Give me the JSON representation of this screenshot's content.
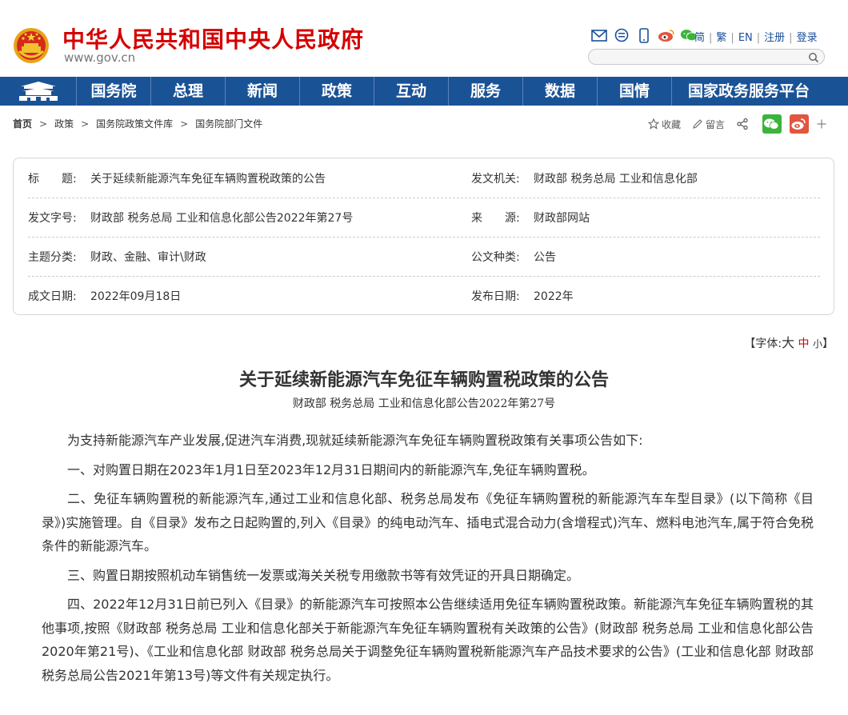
{
  "header": {
    "site_title": "中华人民共和国中央人民政府",
    "site_url": "www.gov.cn",
    "top_links": [
      "简",
      "繁",
      "EN",
      "注册",
      "登录"
    ],
    "search_placeholder": ""
  },
  "nav": [
    "国务院",
    "总理",
    "新闻",
    "政策",
    "互动",
    "服务",
    "数据",
    "国情",
    "国家政务服务平台"
  ],
  "breadcrumb": [
    "首页",
    "政策",
    "国务院政策文件库",
    "国务院部门文件"
  ],
  "tools": {
    "favorite": "收藏",
    "comment": "留言"
  },
  "meta": {
    "title_label": "标　　题:",
    "title_value": "关于延续新能源汽车免征车辆购置税政策的公告",
    "issuer_label": "发文机关:",
    "issuer_value": "财政部  税务总局  工业和信息化部",
    "doc_no_label": "发文字号:",
    "doc_no_value": "财政部  税务总局  工业和信息化部公告2022年第27号",
    "source_label": "来　　源:",
    "source_value": "财政部网站",
    "topic_label": "主题分类:",
    "topic_value": "财政、金融、审计\\财政",
    "type_label": "公文种类:",
    "type_value": "公告",
    "written_label": "成文日期:",
    "written_value": "2022年09月18日",
    "published_label": "发布日期:",
    "published_value": "2022年"
  },
  "font_size": {
    "prefix": "【字体:",
    "big": "大",
    "mid": "中",
    "small": "小",
    "suffix": "】"
  },
  "article": {
    "title": "关于延续新能源汽车免征车辆购置税政策的公告",
    "subtitle": "财政部  税务总局  工业和信息化部公告2022年第27号",
    "paragraphs": [
      "为支持新能源汽车产业发展,促进汽车消费,现就延续新能源汽车免征车辆购置税政策有关事项公告如下:",
      "一、对购置日期在2023年1月1日至2023年12月31日期间内的新能源汽车,免征车辆购置税。",
      "二、免征车辆购置税的新能源汽车,通过工业和信息化部、税务总局发布《免征车辆购置税的新能源汽车车型目录》(以下简称《目录》)实施管理。自《目录》发布之日起购置的,列入《目录》的纯电动汽车、插电式混合动力(含增程式)汽车、燃料电池汽车,属于符合免税条件的新能源汽车。",
      "三、购置日期按照机动车销售统一发票或海关关税专用缴款书等有效凭证的开具日期确定。",
      "四、2022年12月31日前已列入《目录》的新能源汽车可按照本公告继续适用免征车辆购置税政策。新能源汽车免征车辆购置税的其他事项,按照《财政部  税务总局  工业和信息化部关于新能源汽车免征车辆购置税有关政策的公告》(财政部  税务总局  工业和信息化部公告2020年第21号)、《工业和信息化部  财政部  税务总局关于调整免征车辆购置税新能源汽车产品技术要求的公告》(工业和信息化部  财政部  税务总局公告2021年第13号)等文件有关规定执行。"
    ]
  },
  "colors": {
    "brand_red": "#d40000",
    "nav_blue": "#1a5296",
    "wechat_green": "#3ab43a",
    "weibo_red": "#e2553f"
  }
}
